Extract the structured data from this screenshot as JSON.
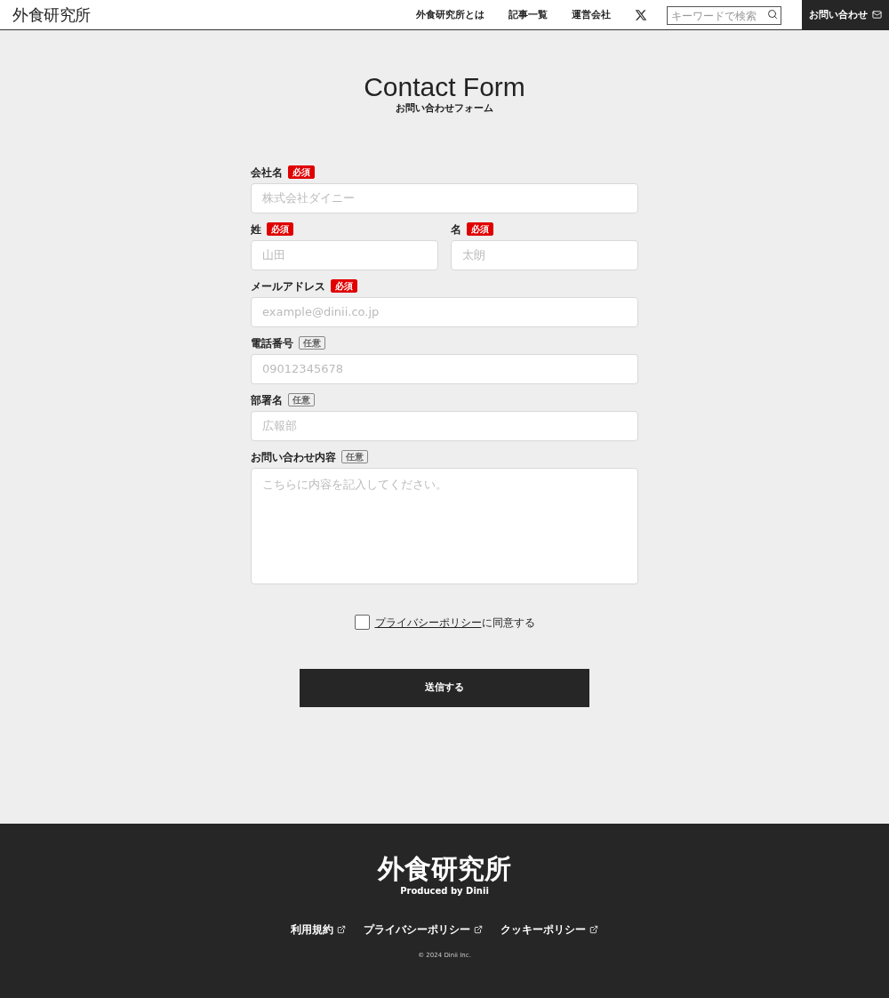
{
  "header": {
    "logo": "外食研究所",
    "nav": [
      "外食研究所とは",
      "記事一覧",
      "運営会社"
    ],
    "search": {
      "placeholder": "キーワードで検索"
    },
    "contact_button": "お問い合わせ"
  },
  "heading": {
    "title": "Contact Form",
    "subtitle": "お問い合わせフォーム"
  },
  "form": {
    "rows": [
      [
        {
          "label": "会社名",
          "badge": "必須",
          "required": true,
          "kind": "input",
          "placeholder": "株式会社ダイニー"
        }
      ],
      [
        {
          "label": "姓",
          "badge": "必須",
          "required": true,
          "kind": "input",
          "placeholder": "山田"
        },
        {
          "label": "名",
          "badge": "必須",
          "required": true,
          "kind": "input",
          "placeholder": "太朗"
        }
      ],
      [
        {
          "label": "メールアドレス",
          "badge": "必須",
          "required": true,
          "kind": "input",
          "placeholder": "example@dinii.co.jp"
        }
      ],
      [
        {
          "label": "電話番号",
          "badge": "任意",
          "required": false,
          "kind": "input",
          "placeholder": "09012345678"
        }
      ],
      [
        {
          "label": "部署名",
          "badge": "任意",
          "required": false,
          "kind": "input",
          "placeholder": "広報部"
        }
      ],
      [
        {
          "label": "お問い合わせ内容",
          "badge": "任意",
          "required": false,
          "kind": "textarea",
          "placeholder": "こちらに内容を記入してください。"
        }
      ]
    ],
    "agreement": {
      "checked": false,
      "link": "プライバシーポリシー",
      "text": "に同意する"
    },
    "submit": "送信する"
  },
  "footer": {
    "logo": "外食研究所",
    "tagline": "Produced by Dinii",
    "links": [
      "利用規約",
      "プライバシーポリシー",
      "クッキーポリシー"
    ],
    "copyright": "© 2024 Dinii Inc."
  }
}
